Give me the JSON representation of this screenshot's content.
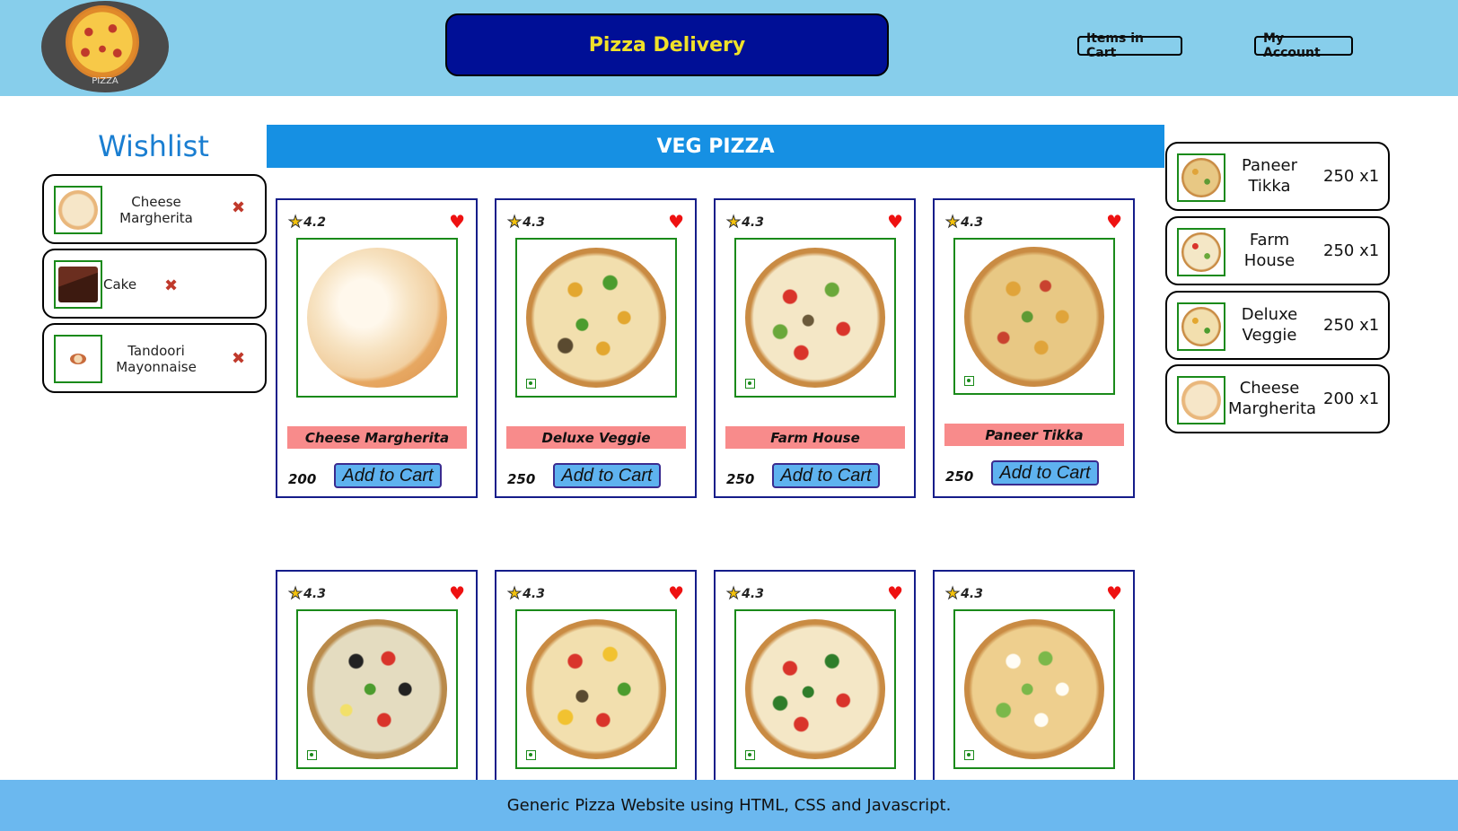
{
  "header": {
    "logo_text": "PIZZA",
    "title": "Pizza Delivery",
    "cart_button": "Items in Cart",
    "account_button": "My Account"
  },
  "wishlist": {
    "title": "Wishlist",
    "remove_icon": "close-icon",
    "items": [
      {
        "name": "Cheese Margherita",
        "thumb": "cheese"
      },
      {
        "name": "Cake",
        "thumb": "cake"
      },
      {
        "name": "Tandoori Mayonnaise",
        "thumb": "dip"
      }
    ]
  },
  "section": {
    "title": "VEG PIZZA"
  },
  "products": [
    {
      "rating": "4.2",
      "name": "Cheese Margherita",
      "price": "200",
      "button": "Add to Cart",
      "style": "cheese"
    },
    {
      "rating": "4.3",
      "name": "Deluxe Veggie",
      "price": "250",
      "button": "Add to Cart",
      "style": "deluxe"
    },
    {
      "rating": "4.3",
      "name": "Farm House",
      "price": "250",
      "button": "Add to Cart",
      "style": "farm"
    },
    {
      "rating": "4.3",
      "name": "Paneer Tikka",
      "price": "250",
      "button": "Add to Cart",
      "style": "paneer"
    },
    {
      "rating": "4.3",
      "name": "",
      "price": "",
      "button": "",
      "style": "olive"
    },
    {
      "rating": "4.3",
      "name": "",
      "price": "",
      "button": "",
      "style": "deluxe2"
    },
    {
      "rating": "4.3",
      "name": "",
      "price": "",
      "button": "",
      "style": "farm2"
    },
    {
      "rating": "4.3",
      "name": "",
      "price": "",
      "button": "",
      "style": "paneer2"
    }
  ],
  "cart": {
    "items": [
      {
        "name_line1": "Paneer",
        "name_line2": "Tikka",
        "price_qty": "250 x1",
        "thumb": "paneer"
      },
      {
        "name_line1": "Farm",
        "name_line2": "House",
        "price_qty": "250 x1",
        "thumb": "farm"
      },
      {
        "name_line1": "Deluxe",
        "name_line2": "Veggie",
        "price_qty": "250 x1",
        "thumb": "deluxe"
      },
      {
        "name_line1": "Cheese",
        "name_line2": "Margherita",
        "price_qty": "200 x1",
        "thumb": "cheese"
      }
    ]
  },
  "footer": {
    "text": "Generic Pizza Website using HTML, CSS and Javascript."
  },
  "colors": {
    "header_bg": "#87ceeb",
    "title_bg": "#000f96",
    "title_text": "#f0e129",
    "banner_bg": "#1690e3",
    "name_bar": "#f88b8b",
    "button_bg": "#5eb2ef",
    "footer_bg": "#6bb8ef",
    "heart": "#ee1111"
  }
}
